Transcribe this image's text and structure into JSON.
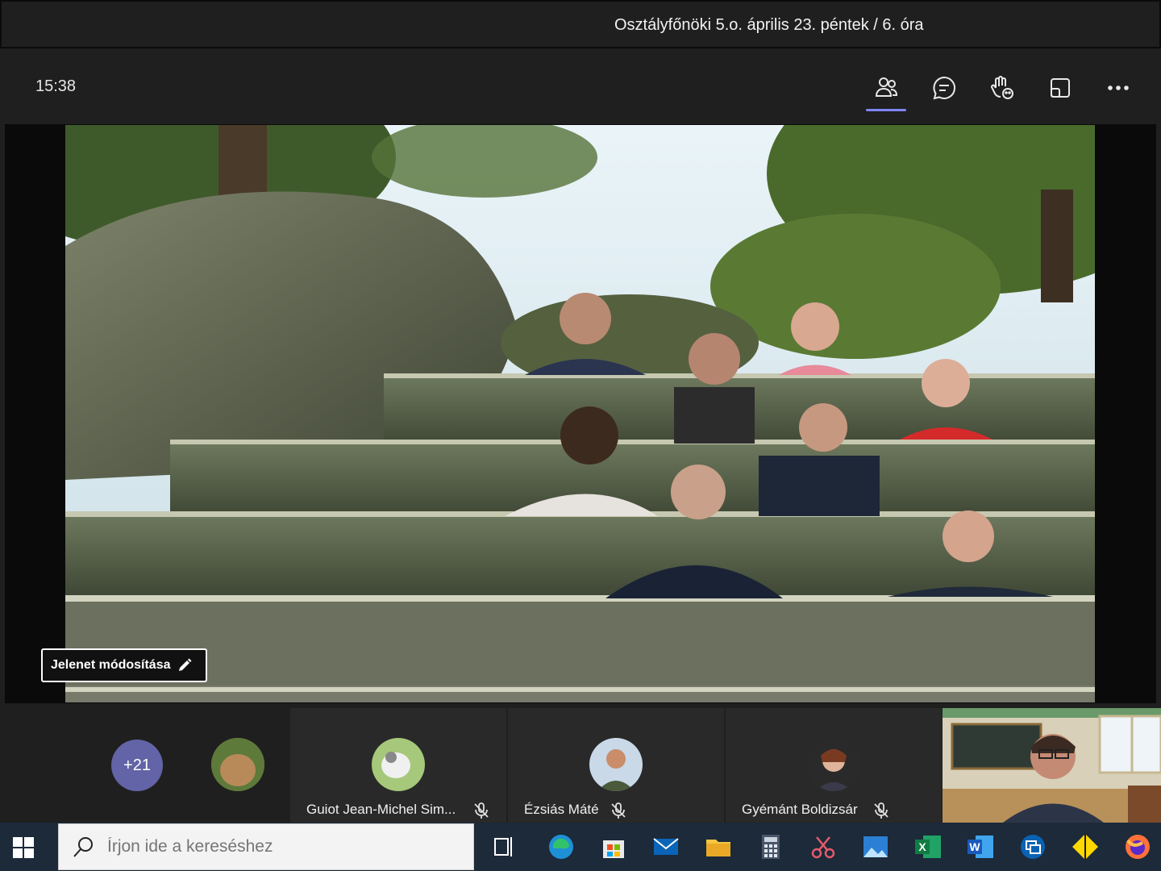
{
  "window": {
    "title": "Osztályfőnöki 5.o. április 23. péntek / 6. óra"
  },
  "toolbar": {
    "clock": "15:38",
    "buttons": [
      "people-icon",
      "chat-icon",
      "reactions-icon",
      "share-icon",
      "more-icon"
    ]
  },
  "scene": {
    "edit_button_label": "Jelenet módosítása"
  },
  "participants": {
    "overflow_count": "+21",
    "tiles": [
      {
        "name": "Guiot Jean-Michel Sim..."
      },
      {
        "name": "Ézsiás Máté"
      },
      {
        "name": "Gyémánt Boldizsár"
      }
    ]
  },
  "taskbar": {
    "search_placeholder": "Írjon ide a kereséshez",
    "apps": [
      "task-view-icon",
      "edge-icon",
      "store-icon",
      "mail-icon",
      "file-explorer-icon",
      "calculator-icon",
      "snip-icon",
      "photos-icon",
      "excel-icon",
      "word-icon",
      "remote-desktop-icon",
      "diamond-app-icon",
      "firefox-icon"
    ]
  },
  "colors": {
    "accent": "#6264a7",
    "active_underline": "#7f85f5",
    "taskbar": "#1c2a3a"
  }
}
